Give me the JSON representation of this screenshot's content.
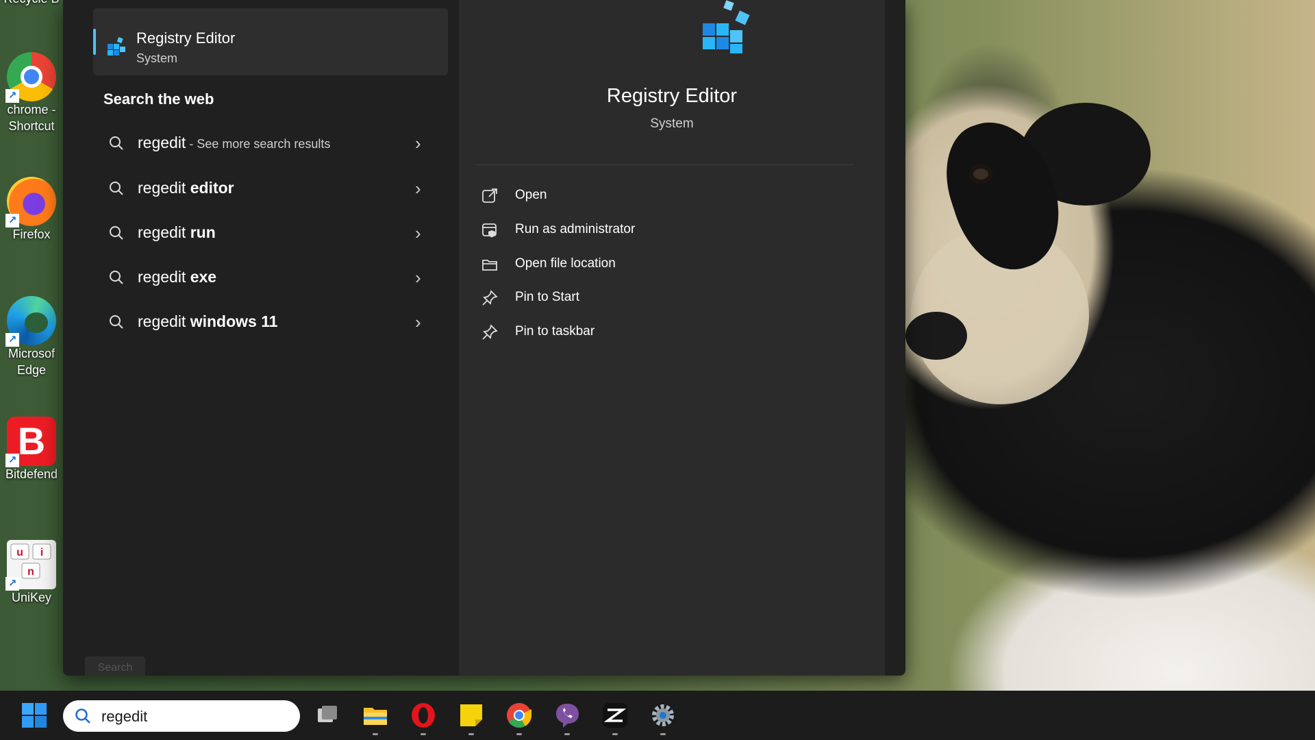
{
  "desktop": {
    "icons": [
      {
        "name": "Recycle Bin",
        "label": "Recycle B"
      },
      {
        "name": "chrome",
        "label": "chrome -",
        "label2": "Shortcut"
      },
      {
        "name": "firefox",
        "label": "Firefox"
      },
      {
        "name": "edge",
        "label": "Microsof",
        "label2": "Edge"
      },
      {
        "name": "bitdefender",
        "label": "Bitdefend"
      },
      {
        "name": "unikey",
        "label": "UniKey"
      }
    ]
  },
  "search_panel": {
    "best_match": {
      "title": "Registry Editor",
      "subtitle": "System"
    },
    "web_section_title": "Search the web",
    "web_results": [
      {
        "query": "regedit",
        "bold": "",
        "extra": " - See more search results"
      },
      {
        "query": "regedit ",
        "bold": "editor",
        "extra": ""
      },
      {
        "query": "regedit ",
        "bold": "run",
        "extra": ""
      },
      {
        "query": "regedit ",
        "bold": "exe",
        "extra": ""
      },
      {
        "query": "regedit ",
        "bold": "windows 11",
        "extra": ""
      }
    ],
    "ghost_button": "Search",
    "detail": {
      "title": "Registry Editor",
      "subtitle": "System",
      "actions": [
        {
          "label": "Open",
          "icon": "open-external-icon"
        },
        {
          "label": "Run as administrator",
          "icon": "shield-admin-icon"
        },
        {
          "label": "Open file location",
          "icon": "folder-icon"
        },
        {
          "label": "Pin to Start",
          "icon": "pin-icon"
        },
        {
          "label": "Pin to taskbar",
          "icon": "pin-icon"
        }
      ]
    }
  },
  "taskbar": {
    "search_value": "regedit",
    "apps": [
      "start",
      "task-view",
      "file-explorer",
      "opera",
      "sticky-notes",
      "chrome",
      "viber",
      "capcut",
      "settings"
    ]
  },
  "colors": {
    "accent": "#4cc2ff",
    "panel": "#202020",
    "detail_pane": "#2b2b2b",
    "taskbar": "#1c1c1c"
  }
}
